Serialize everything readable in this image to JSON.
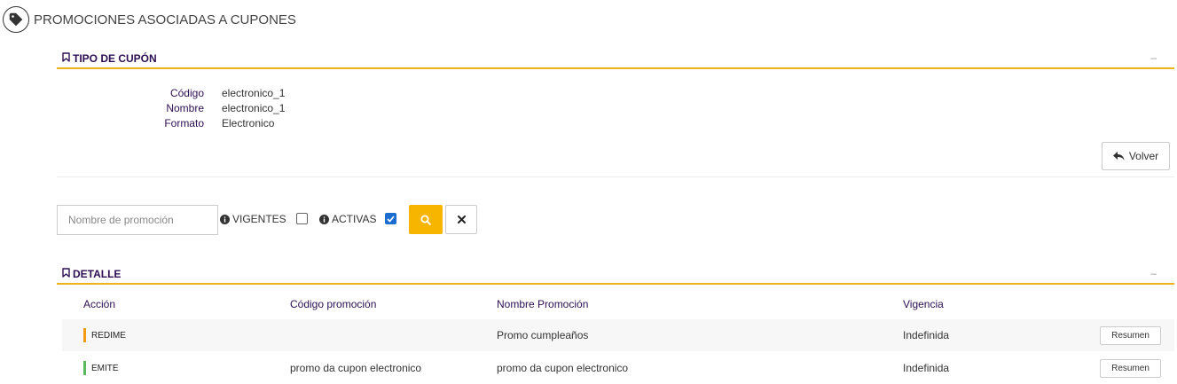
{
  "page": {
    "title": "PROMOCIONES ASOCIADAS A CUPONES",
    "icon": "tag-icon"
  },
  "tipo_cupon": {
    "section_title": "TIPO DE CUPÓN",
    "collapse_symbol": "–",
    "fields": [
      {
        "label": "Código",
        "value": "electronico_1"
      },
      {
        "label": "Nombre",
        "value": "electronico_1"
      },
      {
        "label": "Formato",
        "value": "Electronico"
      }
    ],
    "back_button": "Volver"
  },
  "filters": {
    "search_placeholder": "Nombre de promoción",
    "search_value": "",
    "vigentes_label": "VIGENTES",
    "vigentes_checked": false,
    "activas_label": "ACTIVAS",
    "activas_checked": true
  },
  "detalle": {
    "section_title": "DETALLE",
    "collapse_symbol": "–",
    "columns": [
      "Acción",
      "Código promoción",
      "Nombre Promoción",
      "Vigencia"
    ],
    "rows": [
      {
        "accion": "REDIME",
        "accion_color": "#f39c12",
        "codigo": "",
        "nombre": "Promo cumpleaños",
        "vigencia": "Indefinida",
        "button": "Resumen"
      },
      {
        "accion": "EMITE",
        "accion_color": "#5cb85c",
        "codigo": "promo da cupon electronico",
        "nombre": "promo da cupon electronico",
        "vigencia": "Indefinida",
        "button": "Resumen"
      }
    ]
  },
  "colors": {
    "accent": "#f2b21a",
    "heading": "#2d0f52",
    "search_button": "#f7b500",
    "checkbox": "#1b6ecf"
  }
}
